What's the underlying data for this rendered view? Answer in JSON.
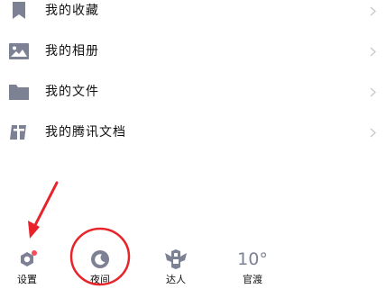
{
  "menu": {
    "items": [
      {
        "label": "我的收藏",
        "icon": "bookmark-icon"
      },
      {
        "label": "我的相册",
        "icon": "photo-album-icon"
      },
      {
        "label": "我的文件",
        "icon": "folder-icon"
      },
      {
        "label": "我的腾讯文档",
        "icon": "tencent-docs-icon"
      }
    ],
    "chevron_icon": "chevron-right-icon"
  },
  "toolbar": {
    "settings_label": "设置",
    "night_label": "夜间",
    "expert_label": "达人",
    "weather_label": "官渡",
    "temperature": "10°"
  },
  "colors": {
    "icon_gray": "#7d8194",
    "text": "#111111",
    "chevron": "#c8c8cc",
    "badge_red": "#f74c5a",
    "annotation_red": "#e8242b"
  }
}
